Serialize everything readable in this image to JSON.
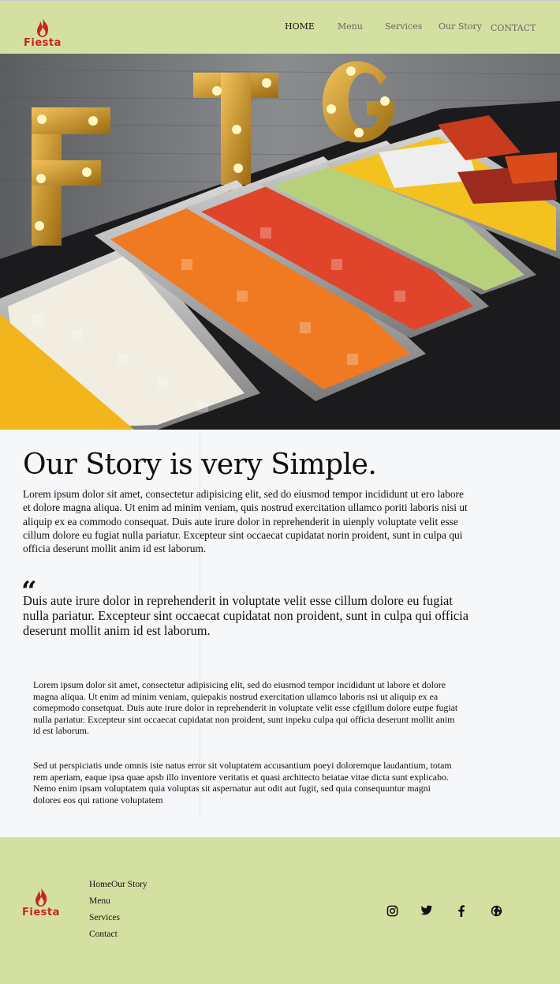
{
  "brand": {
    "name": "Fiesta",
    "logo_color": "#c8261b",
    "header_bg": "#d4e0a1"
  },
  "nav": {
    "items": [
      {
        "label": "HOME",
        "active": true
      },
      {
        "label": "Menu",
        "active": false
      },
      {
        "label": "Services",
        "active": false
      },
      {
        "label": "Our Story",
        "active": false
      },
      {
        "label": "CONTACT",
        "active": false
      }
    ]
  },
  "hero": {
    "icon": "food-buffet-photo",
    "letters": [
      "F",
      "T",
      "G"
    ]
  },
  "story": {
    "title": "Our Story is very Simple.",
    "intro": "Lorem ipsum dolor sit amet, consectetur adipisicing elit, sed do eiusmod tempor incididunt ut ero labore et dolore magna aliqua. Ut enim ad minim veniam, quis nostrud exercitation ullamco poriti laboris nisi ut aliquip ex ea commodo consequat. Duis aute irure dolor in reprehenderit in uienply voluptate velit esse cillum dolore eu fugiat nulla pariatur. Excepteur sint occaecat cupidatat norin proident, sunt in culpa qui officia deserunt mollit anim id est laborum.",
    "quote_mark": "“",
    "quote": "Duis aute irure dolor in reprehenderit in voluptate velit esse cillum dolore eu fugiat nulla pariatur. Excepteur sint occaecat cupidatat non proident, sunt in culpa qui officia deserunt mollit anim id est laborum.",
    "para2": "Lorem ipsum dolor sit amet, consectetur adipisicing elit, sed do eiusmod tempor incididunt ut labore et dolore magna aliqua. Ut enim ad minim veniam, quiepakis nostrud exercitation ullamco laboris nsi ut aliquip ex ea comepmodo consetquat. Duis aute irure dolor in reprehenderit in voluptate velit esse cfgillum dolore eutpe fugiat nulla pariatur. Excepteur sint occaecat cupidatat non proident, sunt inpeku culpa qui officia deserunt mollit anim id est laborum.",
    "para3": "Sed ut perspiciatis unde omnis iste natus error sit voluptatem accusantium poeyi doloremque laudantium, totam rem aperiam, eaque ipsa quae apsb illo inventore veritatis et quasi architecto beiatae vitae dicta sunt explicabo. Nemo enim ipsam voluptatem quia voluptas sit aspernatur aut odit aut fugit, sed quia consequuntur magni dolores eos qui ratione voluptatem"
  },
  "footer": {
    "links": [
      "Home",
      "Our Story",
      "Menu",
      "Services",
      "Contact"
    ],
    "social": [
      "instagram-icon",
      "twitter-icon",
      "facebook-icon",
      "globe-icon"
    ]
  }
}
